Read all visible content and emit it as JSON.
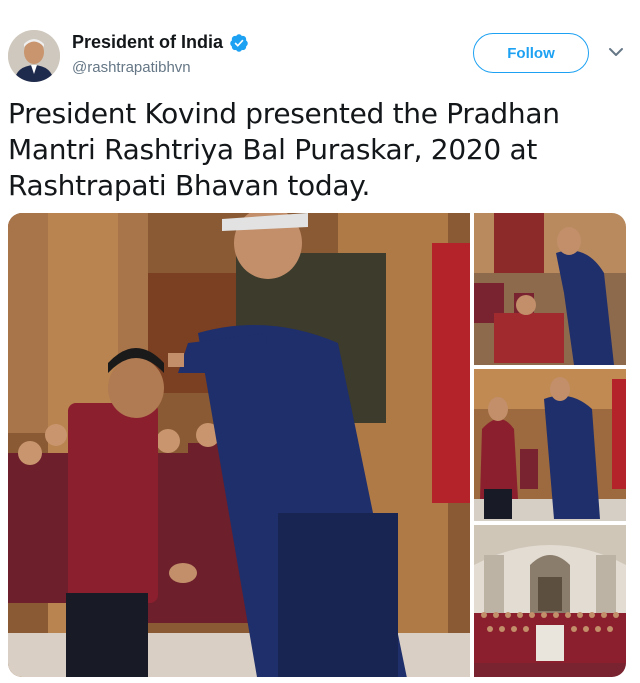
{
  "tweet": {
    "author": {
      "display_name": "President of India",
      "handle": "@rashtrapatibhvn",
      "verified": true,
      "avatar_icon": "profile-photo"
    },
    "follow_label": "Follow",
    "menu_icon": "chevron-down-icon",
    "text": "President Kovind presented the Pradhan Mantri Rashtriya Bal Puraskar, 2020 at Rashtrapati Bhavan today.",
    "media": {
      "count": 4,
      "photos": [
        "award-ceremony-main",
        "award-ceremony-wheelchair",
        "award-ceremony-girl",
        "group-photo-hall"
      ]
    }
  },
  "colors": {
    "accent": "#1da1f2",
    "text_primary": "#14171a",
    "text_secondary": "#657786"
  }
}
